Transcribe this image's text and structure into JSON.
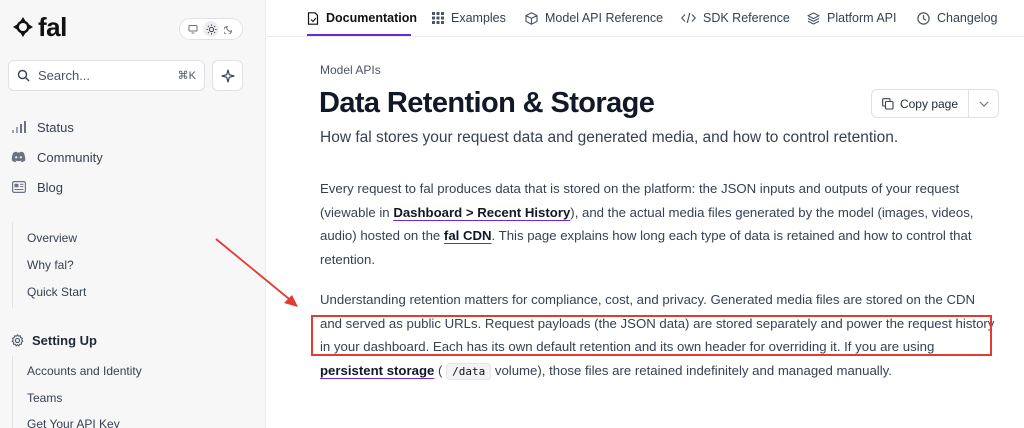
{
  "brand": {
    "name": "fal"
  },
  "theme": {
    "options": [
      "monitor-icon",
      "sun-icon",
      "moon-icon"
    ],
    "active": "sun-icon"
  },
  "search": {
    "placeholder": "Search...",
    "shortcut": "⌘K"
  },
  "sidebar": {
    "links": [
      {
        "label": "Status",
        "icon": "status-bars-icon"
      },
      {
        "label": "Community",
        "icon": "discord-icon"
      },
      {
        "label": "Blog",
        "icon": "blog-icon"
      }
    ],
    "intro": [
      "Overview",
      "Why fal?",
      "Quick Start"
    ],
    "section": {
      "title": "Setting Up",
      "icon": "gear-icon"
    },
    "setup": [
      "Accounts and Identity",
      "Teams",
      "Get Your API Key"
    ]
  },
  "topnav": {
    "tabs": [
      {
        "label": "Documentation",
        "icon": "doc-icon",
        "active": true
      },
      {
        "label": "Examples",
        "icon": "grid-icon"
      },
      {
        "label": "Model API Reference",
        "icon": "cube-icon"
      },
      {
        "label": "SDK Reference",
        "icon": "code-icon"
      },
      {
        "label": "Platform API",
        "icon": "layers-icon"
      },
      {
        "label": "Changelog",
        "icon": "clock-icon"
      }
    ]
  },
  "page": {
    "breadcrumb": "Model APIs",
    "title": "Data Retention & Storage",
    "copy_label": "Copy page",
    "subtitle": "How fal stores your request data and generated media, and how to control retention.",
    "p1": {
      "t1": "Every request to fal produces data that is stored on the platform: the JSON inputs and outputs of your request (viewable in ",
      "link1": "Dashboard > Recent History",
      "t2": "), and the actual media files generated by the model (images, videos, audio) hosted on the ",
      "link2": "fal CDN",
      "t3": ". This page explains how long each type of data is retained and how to control that retention."
    },
    "p2": {
      "t1": "Understanding retention matters for compliance, cost, and privacy. Generated media files are stored on the CDN and served as public URLs. Request payloads (the JSON data) are stored separately and power the request history in your dashboard. Each has its own default retention and its own header for overriding it. If you are using ",
      "link1": "persistent storage",
      "t2": " (",
      "code": "/data",
      "t3": " volume), those files are retained indefinitely and managed manually."
    }
  },
  "colors": {
    "accent": "#6d28d9",
    "annotation": "#e23b32"
  }
}
